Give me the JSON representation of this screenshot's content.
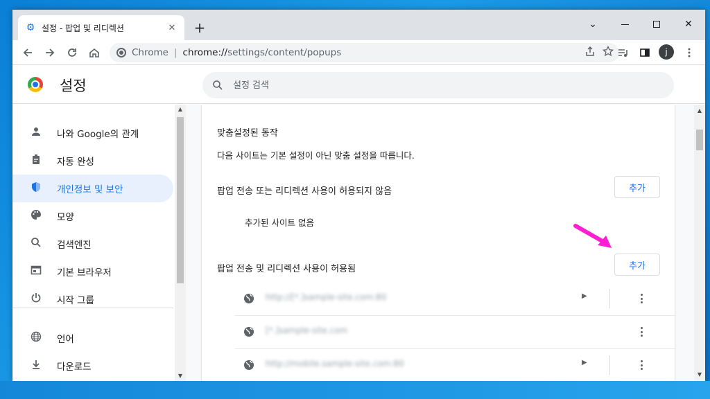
{
  "tab": {
    "title": "설정 - 팝업 및 리디렉션",
    "close": "✕",
    "new_tab": "+"
  },
  "window_controls": {
    "menu": "⌄",
    "close": "✕"
  },
  "omnibox": {
    "label": "Chrome",
    "separator": "|",
    "host": "chrome://",
    "path": "settings/content/popups"
  },
  "account": {
    "initial": "j"
  },
  "header": {
    "title": "설정",
    "search_placeholder": "설정 검색"
  },
  "sidebar": {
    "items": [
      {
        "label": "나와 Google의 관계",
        "icon": "person-icon"
      },
      {
        "label": "자동 완성",
        "icon": "clipboard-icon"
      },
      {
        "label": "개인정보 및 보안",
        "icon": "shield-icon",
        "active": true
      },
      {
        "label": "모양",
        "icon": "palette-icon"
      },
      {
        "label": "검색엔진",
        "icon": "search-icon"
      },
      {
        "label": "기본 브라우저",
        "icon": "browser-icon"
      },
      {
        "label": "시작 그룹",
        "icon": "power-icon"
      },
      {
        "label": "언어",
        "icon": "globe-icon"
      },
      {
        "label": "다운로드",
        "icon": "download-icon"
      }
    ]
  },
  "content": {
    "custom_title": "맞춤설정된 동작",
    "custom_desc": "다음 사이트는 기본 설정이 아닌 맞춤 설정을 따릅니다.",
    "blocked_label": "팝업 전송 또는 리디렉션 사용이 허용되지 않음",
    "add_label": "추가",
    "no_sites": "추가된 사이트 없음",
    "allowed_label": "팝업 전송 및 리디렉션 사용이 허용됨",
    "allowed_sites": [
      {
        "url": "http://[*.]sample-site.com:80"
      },
      {
        "url": "[*.]sample-site.com"
      },
      {
        "url": "http://mobile.sample-site.com:80"
      }
    ]
  },
  "colors": {
    "accent": "#1a73e8",
    "annotation_arrow": "#ff1fd2"
  }
}
